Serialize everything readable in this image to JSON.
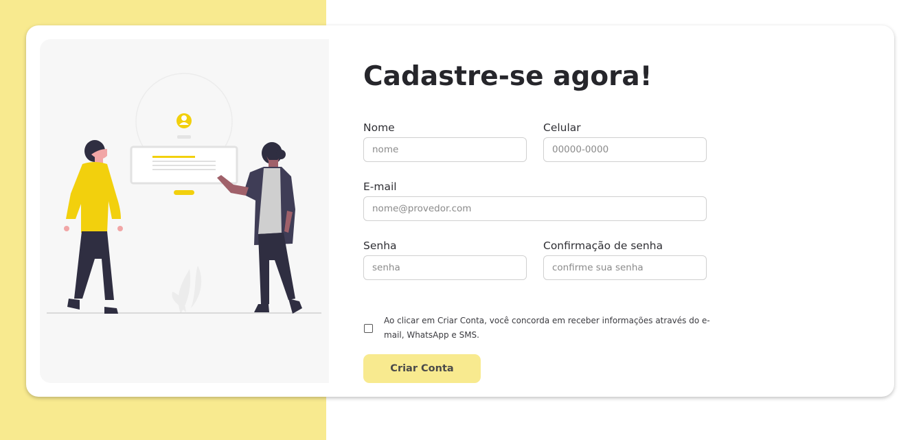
{
  "form": {
    "title": "Cadastre-se agora!",
    "nome": {
      "label": "Nome",
      "placeholder": "nome",
      "value": ""
    },
    "celular": {
      "label": "Celular",
      "placeholder": "00000-0000",
      "value": ""
    },
    "email": {
      "label": "E-mail",
      "placeholder": "nome@provedor.com",
      "value": ""
    },
    "senha": {
      "label": "Senha",
      "placeholder": "senha",
      "value": ""
    },
    "confirmacao": {
      "label": "Confirmação de senha",
      "placeholder": "confirme sua senha",
      "value": ""
    },
    "consent_text": "Ao clicar em Criar Conta, você concorda em receber informações através do e-mail, WhatsApp e SMS.",
    "consent_checked": false,
    "submit_label": "Criar Conta"
  },
  "colors": {
    "accent_yellow": "#f8ea8f",
    "illustration_yellow": "#f2d00d",
    "text_dark": "#26262b"
  },
  "icons": {
    "illustration": "people-signup-illustration",
    "profile": "user-profile-icon"
  }
}
